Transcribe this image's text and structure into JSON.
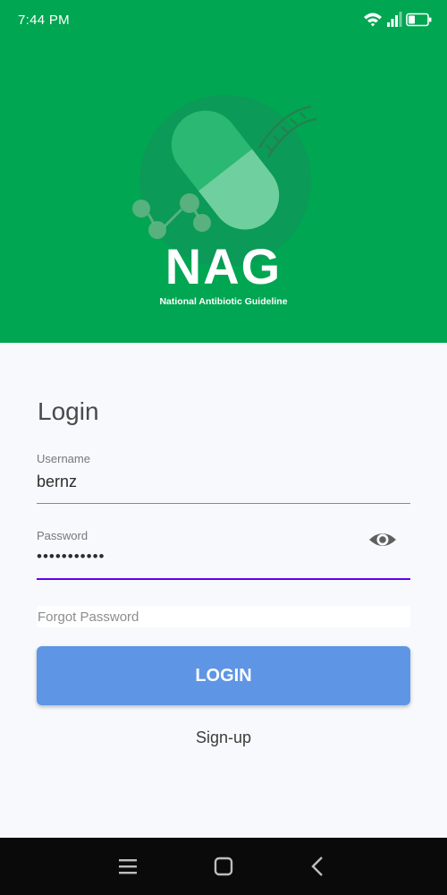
{
  "status_bar": {
    "time": "7:44 PM",
    "icons": [
      "wifi-icon",
      "signal-icon",
      "battery-icon"
    ],
    "battery_level": 0.35
  },
  "header": {
    "background": "#00a651",
    "app_name": "NAG",
    "app_subtitle": "National Antibiotic Guideline"
  },
  "login": {
    "title": "Login",
    "username": {
      "label": "Username",
      "value": "bernz"
    },
    "password": {
      "label": "Password",
      "value": "•••••••••••",
      "visibility_icon": "eye-icon"
    },
    "forgot_password": "Forgot Password",
    "login_button": "LOGIN",
    "signup_link": "Sign-up"
  },
  "colors": {
    "accent": "#6200ee",
    "button": "#5e95e4",
    "brand_green": "#00a651"
  },
  "nav_bar": {
    "buttons": [
      "menu-icon",
      "home-icon",
      "back-icon"
    ]
  }
}
